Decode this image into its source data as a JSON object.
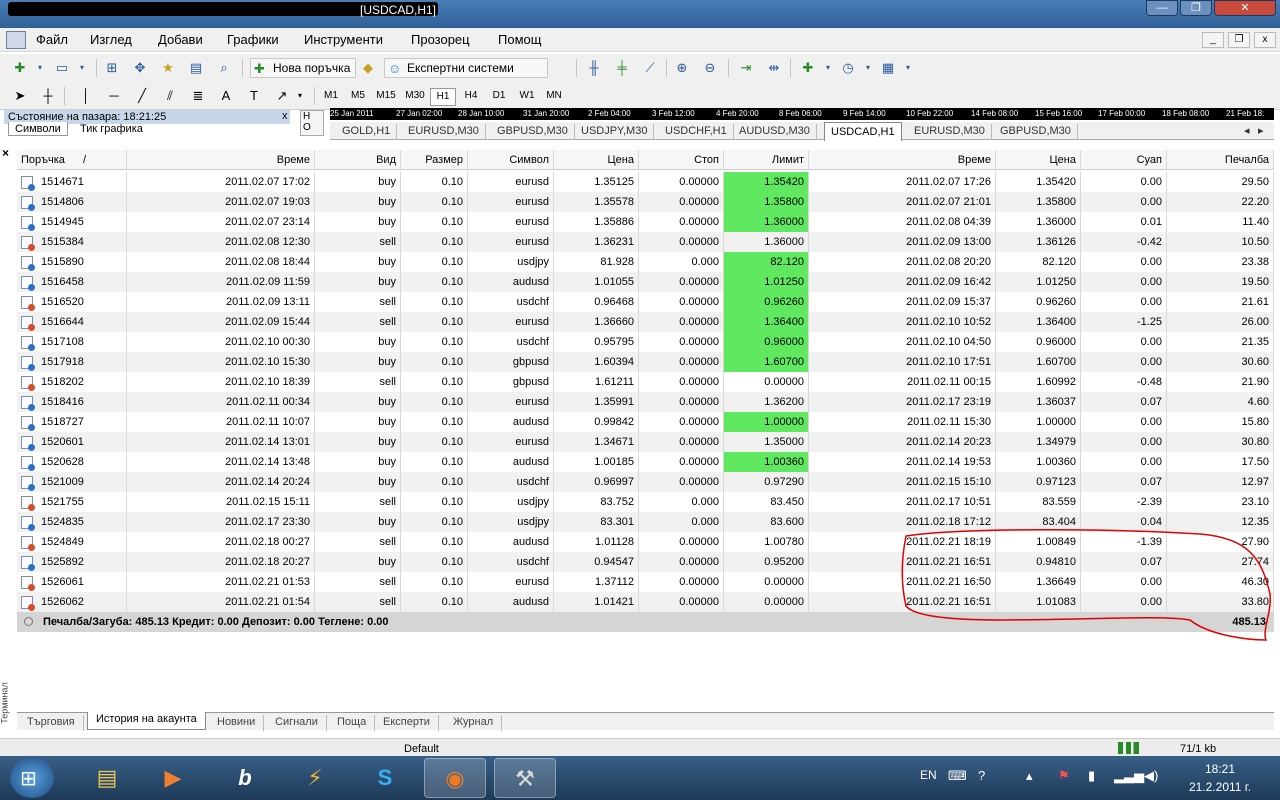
{
  "window": {
    "title": "[USDCAD,H1]",
    "controls": {
      "minimize": "—",
      "maximize": "❐",
      "close": "✕"
    }
  },
  "menu": [
    "Файл",
    "Изглед",
    "Добави",
    "Графики",
    "Инструменти",
    "Прозорец",
    "Помощ"
  ],
  "toolbar": {
    "new_order": "Нова поръчка",
    "experts": "Експертни системи"
  },
  "timeframes": [
    "M1",
    "M5",
    "M15",
    "M30",
    "H1",
    "H4",
    "D1",
    "W1",
    "MN"
  ],
  "active_timeframe": "H1",
  "market_watch": {
    "title": "Състояние на пазара: 18:21:25",
    "close": "x",
    "tabs": [
      "Символи",
      "Тик графика"
    ]
  },
  "navigator_stub": "Н\nО",
  "time_axis": [
    "25 Jan 2011",
    "27 Jan 02:00",
    "28 Jan 10:00",
    "31 Jan 20:00",
    "2 Feb 04:00",
    "3 Feb 12:00",
    "4 Feb 20:00",
    "8 Feb 06:00",
    "9 Feb 14:00",
    "10 Feb 22:00",
    "14 Feb 08:00",
    "15 Feb 16:00",
    "17 Feb 00:00",
    "18 Feb 08:00",
    "21 Feb 18:"
  ],
  "chart_tabs": [
    "GOLD,H1",
    "EURUSD,M30",
    "GBPUSD,M30",
    "USDJPY,M30",
    "USDCHF,H1",
    "AUDUSD,M30",
    "USDCAD,H1",
    "EURUSD,M30",
    "GBPUSD,M30"
  ],
  "active_chart_tab": "USDCAD,H1",
  "terminal": {
    "close": "×",
    "side_label": "Терминал",
    "columns": [
      "Поръчка",
      "/",
      "Време",
      "Вид",
      "Размер",
      "Символ",
      "Цена",
      "Стоп",
      "Лимит",
      "Време",
      "Цена",
      "Суап",
      "Печалба"
    ],
    "rows": [
      [
        "1514671",
        "2011.02.07 17:02",
        "buy",
        "0.10",
        "eurusd",
        "1.35125",
        "0.00000",
        "1.35420",
        "2011.02.07 17:26",
        "1.35420",
        "0.00",
        "29.50",
        1
      ],
      [
        "1514806",
        "2011.02.07 19:03",
        "buy",
        "0.10",
        "eurusd",
        "1.35578",
        "0.00000",
        "1.35800",
        "2011.02.07 21:01",
        "1.35800",
        "0.00",
        "22.20",
        1
      ],
      [
        "1514945",
        "2011.02.07 23:14",
        "buy",
        "0.10",
        "eurusd",
        "1.35886",
        "0.00000",
        "1.36000",
        "2011.02.08 04:39",
        "1.36000",
        "0.01",
        "11.40",
        1
      ],
      [
        "1515384",
        "2011.02.08 12:30",
        "sell",
        "0.10",
        "eurusd",
        "1.36231",
        "0.00000",
        "1.36000",
        "2011.02.09 13:00",
        "1.36126",
        "-0.42",
        "10.50",
        0
      ],
      [
        "1515890",
        "2011.02.08 18:44",
        "buy",
        "0.10",
        "usdjpy",
        "81.928",
        "0.000",
        "82.120",
        "2011.02.08 20:20",
        "82.120",
        "0.00",
        "23.38",
        1
      ],
      [
        "1516458",
        "2011.02.09 11:59",
        "buy",
        "0.10",
        "audusd",
        "1.01055",
        "0.00000",
        "1.01250",
        "2011.02.09 16:42",
        "1.01250",
        "0.00",
        "19.50",
        1
      ],
      [
        "1516520",
        "2011.02.09 13:11",
        "sell",
        "0.10",
        "usdchf",
        "0.96468",
        "0.00000",
        "0.96260",
        "2011.02.09 15:37",
        "0.96260",
        "0.00",
        "21.61",
        1
      ],
      [
        "1516644",
        "2011.02.09 15:44",
        "sell",
        "0.10",
        "eurusd",
        "1.36660",
        "0.00000",
        "1.36400",
        "2011.02.10 10:52",
        "1.36400",
        "-1.25",
        "26.00",
        1
      ],
      [
        "1517108",
        "2011.02.10 00:30",
        "buy",
        "0.10",
        "usdchf",
        "0.95795",
        "0.00000",
        "0.96000",
        "2011.02.10 04:50",
        "0.96000",
        "0.00",
        "21.35",
        1
      ],
      [
        "1517918",
        "2011.02.10 15:30",
        "buy",
        "0.10",
        "gbpusd",
        "1.60394",
        "0.00000",
        "1.60700",
        "2011.02.10 17:51",
        "1.60700",
        "0.00",
        "30.60",
        1
      ],
      [
        "1518202",
        "2011.02.10 18:39",
        "sell",
        "0.10",
        "gbpusd",
        "1.61211",
        "0.00000",
        "0.00000",
        "2011.02.11 00:15",
        "1.60992",
        "-0.48",
        "21.90",
        0
      ],
      [
        "1518416",
        "2011.02.11 00:34",
        "buy",
        "0.10",
        "eurusd",
        "1.35991",
        "0.00000",
        "1.36200",
        "2011.02.17 23:19",
        "1.36037",
        "0.07",
        "4.60",
        0
      ],
      [
        "1518727",
        "2011.02.11 10:07",
        "buy",
        "0.10",
        "audusd",
        "0.99842",
        "0.00000",
        "1.00000",
        "2011.02.11 15:30",
        "1.00000",
        "0.00",
        "15.80",
        1
      ],
      [
        "1520601",
        "2011.02.14 13:01",
        "buy",
        "0.10",
        "eurusd",
        "1.34671",
        "0.00000",
        "1.35000",
        "2011.02.14 20:23",
        "1.34979",
        "0.00",
        "30.80",
        0
      ],
      [
        "1520628",
        "2011.02.14 13:48",
        "buy",
        "0.10",
        "audusd",
        "1.00185",
        "0.00000",
        "1.00360",
        "2011.02.14 19:53",
        "1.00360",
        "0.00",
        "17.50",
        1
      ],
      [
        "1521009",
        "2011.02.14 20:24",
        "buy",
        "0.10",
        "usdchf",
        "0.96997",
        "0.00000",
        "0.97290",
        "2011.02.15 15:10",
        "0.97123",
        "0.07",
        "12.97",
        0
      ],
      [
        "1521755",
        "2011.02.15 15:11",
        "sell",
        "0.10",
        "usdjpy",
        "83.752",
        "0.000",
        "83.450",
        "2011.02.17 10:51",
        "83.559",
        "-2.39",
        "23.10",
        0
      ],
      [
        "1524835",
        "2011.02.17 23:30",
        "buy",
        "0.10",
        "usdjpy",
        "83.301",
        "0.000",
        "83.600",
        "2011.02.18 17:12",
        "83.404",
        "0.04",
        "12.35",
        0
      ],
      [
        "1524849",
        "2011.02.18 00:27",
        "sell",
        "0.10",
        "audusd",
        "1.01128",
        "0.00000",
        "1.00780",
        "2011.02.21 18:19",
        "1.00849",
        "-1.39",
        "27.90",
        0
      ],
      [
        "1525892",
        "2011.02.18 20:27",
        "buy",
        "0.10",
        "usdchf",
        "0.94547",
        "0.00000",
        "0.95200",
        "2011.02.21 16:51",
        "0.94810",
        "0.07",
        "27.74",
        0
      ],
      [
        "1526061",
        "2011.02.21 01:53",
        "sell",
        "0.10",
        "eurusd",
        "1.37112",
        "0.00000",
        "0.00000",
        "2011.02.21 16:50",
        "1.36649",
        "0.00",
        "46.30",
        0
      ],
      [
        "1526062",
        "2011.02.21 01:54",
        "sell",
        "0.10",
        "audusd",
        "1.01421",
        "0.00000",
        "0.00000",
        "2011.02.21 16:51",
        "1.01083",
        "0.00",
        "33.80",
        0
      ]
    ],
    "summary": "Печалба/Загуба: 485.13  Кредит: 0.00  Депозит: 0.00  Теглене: 0.00",
    "summary_total": "485.13",
    "tabs": [
      "Търговия",
      "История на акаунта",
      "Новини",
      "Сигнали",
      "Поща",
      "Експерти",
      "Журнал"
    ],
    "active_tab": "История на акаунта"
  },
  "status": {
    "profile": "Default",
    "traffic": "71/1 kb"
  },
  "taskbar": {
    "start_icon": "windows-logo",
    "apps": [
      "folder-icon",
      "media-player-icon",
      "b-app-icon",
      "winamp-icon",
      "skype-icon",
      "firefox-icon",
      "metatrader-icon"
    ],
    "apps_glyphs": [
      "▤",
      "▶",
      "b",
      "⚡",
      "S",
      "◉",
      "⚒"
    ],
    "language": "EN",
    "tray_glyphs": [
      "⌨",
      "?",
      "▴",
      "⚑",
      "▮",
      "▂▃▅",
      "◀)"
    ],
    "time": "18:21",
    "date": "21.2.2011 г."
  },
  "colors": {
    "limit_hit": "#60e860",
    "annotation": "#e00000"
  }
}
